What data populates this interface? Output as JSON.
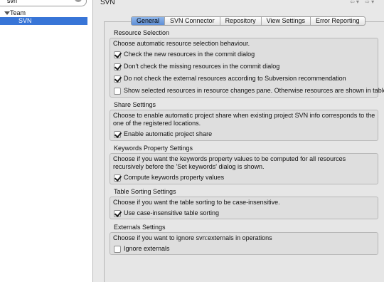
{
  "sidebar": {
    "search_value": "svn",
    "search_clear_glyph": "×",
    "tree": [
      {
        "label": "Team"
      },
      {
        "label": "SVN"
      }
    ]
  },
  "page": {
    "title": "SVN",
    "nav": {
      "back": "⇦ ▾",
      "forward": "⇨ ▾"
    }
  },
  "tabs": [
    {
      "label": "General",
      "active": true
    },
    {
      "label": "SVN Connector",
      "active": false
    },
    {
      "label": "Repository",
      "active": false
    },
    {
      "label": "View Settings",
      "active": false
    },
    {
      "label": "Error Reporting",
      "active": false
    }
  ],
  "groups": {
    "resource_selection": {
      "title": "Resource Selection",
      "desc": "Choose automatic resource selection behaviour.",
      "options": [
        {
          "label": "Check the new resources in the commit dialog",
          "checked": true
        },
        {
          "label": "Don't check the missing resources in the commit dialog",
          "checked": true
        },
        {
          "label": "Do not check the external resources according to Subversion recommendation",
          "checked": true
        },
        {
          "label": "Show selected resources in resource changes pane. Otherwise resources are shown in table",
          "checked": false
        }
      ]
    },
    "share_settings": {
      "title": "Share Settings",
      "desc": "Choose to enable automatic project share when existing project SVN info corresponds to the one of the registered locations.",
      "options": [
        {
          "label": "Enable automatic project share",
          "checked": true
        }
      ]
    },
    "keywords": {
      "title": "Keywords Property Settings",
      "desc": "Choose if you want the keywords property values to be computed for all resources recursively before the 'Set keywords' dialog is shown.",
      "options": [
        {
          "label": "Compute keywords property values",
          "checked": true
        }
      ]
    },
    "table_sorting": {
      "title": "Table Sorting Settings",
      "desc": "Choose if you want the table sorting to be case-insensitive.",
      "options": [
        {
          "label": "Use case-insensitive table sorting",
          "checked": true
        }
      ]
    },
    "externals": {
      "title": "Externals Settings",
      "desc": "Choose if you want to ignore svn:externals in operations",
      "options": [
        {
          "label": "Ignore externals",
          "checked": false
        }
      ]
    }
  },
  "colors": {
    "selection": "#3875d7",
    "active_tab": "#6f9be0"
  }
}
